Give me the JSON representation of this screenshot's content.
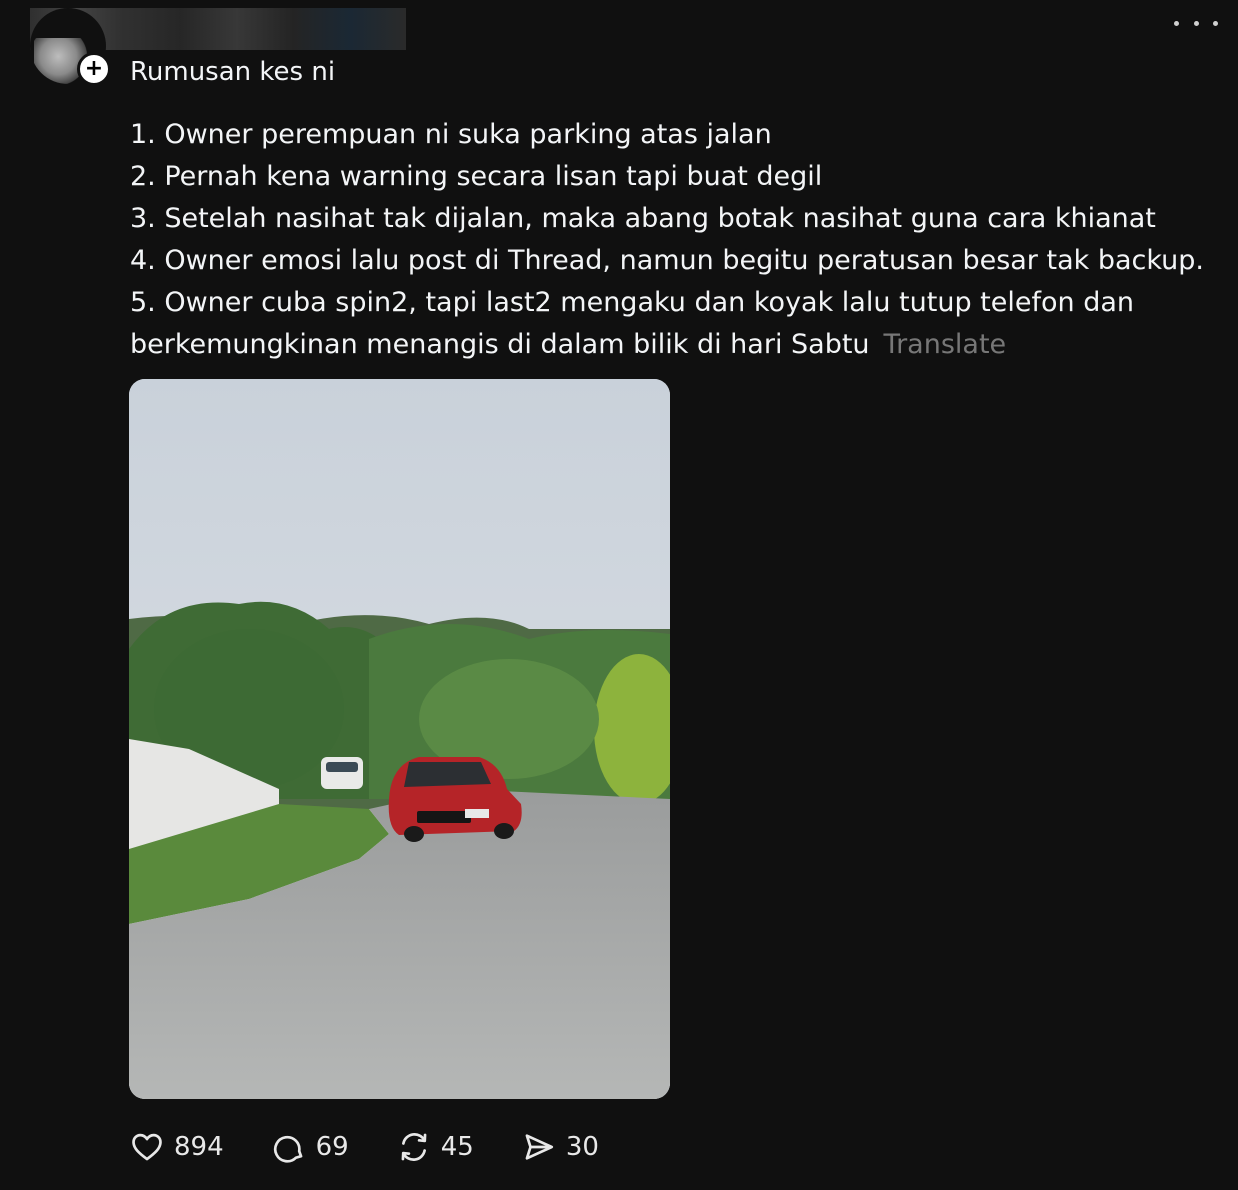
{
  "post": {
    "title": "Rumusan kes ni",
    "lines": [
      "1. Owner perempuan ni suka parking atas jalan",
      "2. Pernah kena warning secara lisan tapi buat degil",
      "3. Setelah nasihat tak dijalan, maka abang botak nasihat guna cara khianat",
      "4. Owner emosi lalu post di Thread, namun begitu peratusan besar tak backup.",
      "5. Owner cuba spin2, tapi last2 mengaku dan koyak lalu tutup telefon dan",
      "berkemungkinan menangis di dalam bilik di hari Sabtu"
    ],
    "translate_label": "Translate"
  },
  "actions": {
    "likes": "894",
    "replies": "69",
    "reposts": "45",
    "shares": "30"
  },
  "icons": {
    "like": "heart-icon",
    "reply": "comment-bubble-icon",
    "repost": "repost-icon",
    "share": "send-icon",
    "more": "more-dots-icon",
    "follow": "plus-icon"
  },
  "colors": {
    "background": "#101010",
    "text": "#f3f5f7",
    "muted": "#777777"
  }
}
